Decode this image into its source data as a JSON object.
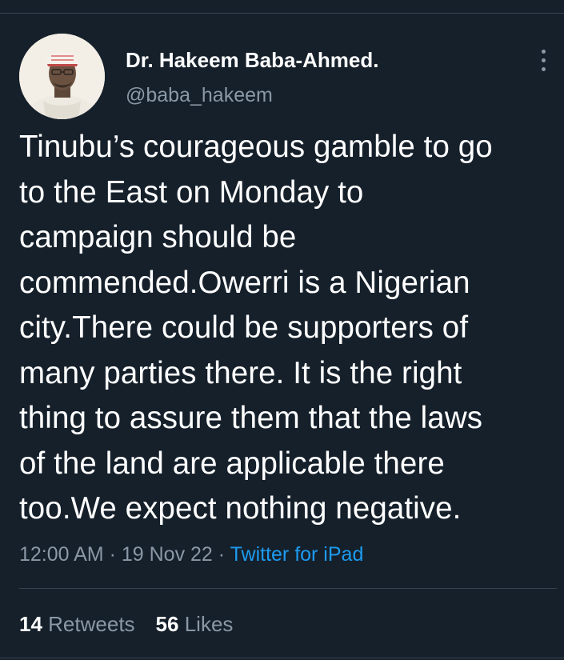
{
  "author": {
    "display_name": "Dr. Hakeem Baba-Ahmed.",
    "handle": "@baba_hakeem"
  },
  "tweet": {
    "lines": [
      "Tinubu’s courageous gamble to go",
      "to the East on Monday to",
      "campaign should be",
      "commended.Owerri is a Nigerian",
      "city.There could be supporters of",
      "many parties there. It is the right",
      "thing to assure them that the laws",
      "of the land are applicable there",
      "too.We expect nothing negative."
    ],
    "time": "12:00 AM",
    "date": "19 Nov 22",
    "separator": "·",
    "source": "Twitter for iPad"
  },
  "stats": {
    "retweets_count": "14",
    "retweets_label": "Retweets",
    "likes_count": "56",
    "likes_label": "Likes"
  },
  "icons": {
    "more": "more-vertical-icon"
  },
  "colors": {
    "background": "#15202b",
    "text_primary": "#ffffff",
    "text_secondary": "#8b98a5",
    "link": "#1d9bf0",
    "divider": "#38444d"
  }
}
